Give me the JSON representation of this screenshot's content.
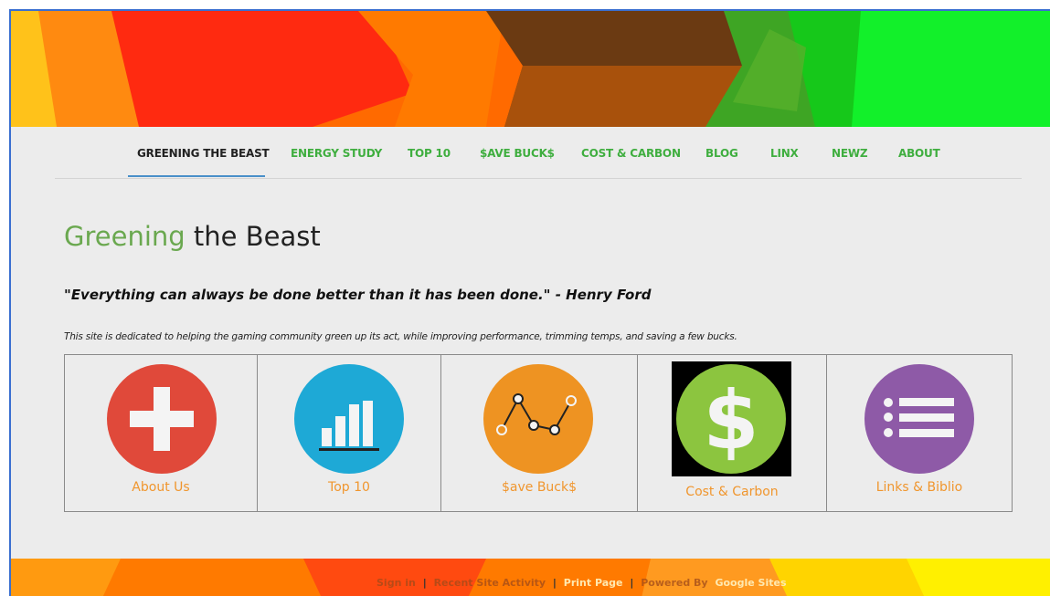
{
  "nav": {
    "items": [
      {
        "label": "GREENING THE BEAST",
        "active": true
      },
      {
        "label": "ENERGY STUDY"
      },
      {
        "label": "TOP 10"
      },
      {
        "label": "$AVE BUCK$"
      },
      {
        "label": "COST & CARBON"
      },
      {
        "label": "BLOG"
      },
      {
        "label": "LINX"
      },
      {
        "label": "NEWZ"
      },
      {
        "label": "ABOUT"
      }
    ]
  },
  "page": {
    "title_accent": "Greening",
    "title_rest": " the Beast",
    "quote": "\"Everything can always be done better than it has been done.\"  - Henry Ford",
    "description": "This site is dedicated to helping the gaming community green up its act, while improving performance, trimming temps, and saving a few bucks."
  },
  "cards": [
    {
      "label": "About Us",
      "icon": "plus-icon",
      "color": "#e0493a"
    },
    {
      "label": "Top 10",
      "icon": "bar-chart-icon",
      "color": "#1ea9d6"
    },
    {
      "label": "$ave Buck$",
      "icon": "line-chart-icon",
      "color": "#ee9322"
    },
    {
      "label": "Cost & Carbon",
      "icon": "dollar-icon",
      "color": "#8cc53f"
    },
    {
      "label": "Links & Biblio",
      "icon": "list-icon",
      "color": "#8e5aa7"
    }
  ],
  "footer": {
    "links": [
      "Sign in",
      "Recent Site Activity",
      "Print Page",
      "Powered By",
      "Google Sites"
    ],
    "separator": "|"
  },
  "colors": {
    "nav_link": "#3fae3f",
    "title_accent": "#6aa84f",
    "card_label": "#f0962e"
  }
}
